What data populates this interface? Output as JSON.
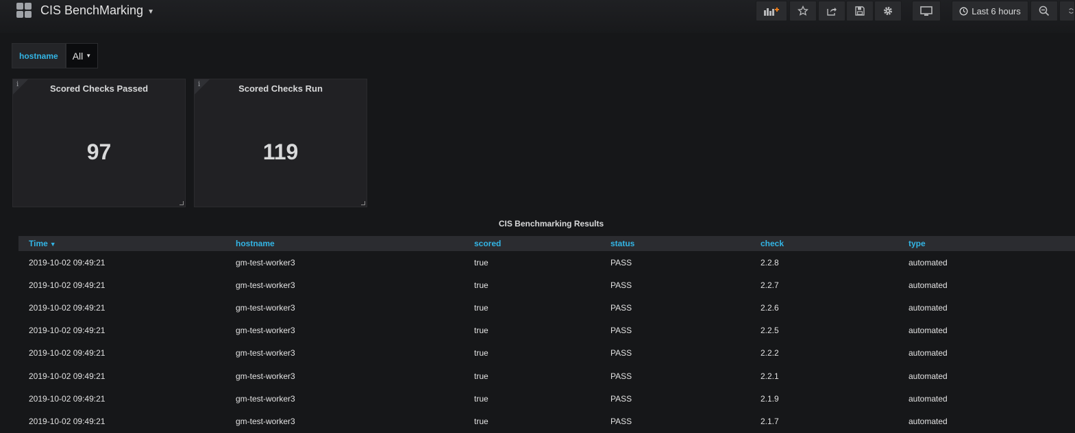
{
  "dashboard": {
    "title": "CIS BenchMarking"
  },
  "toolbar": {
    "time_range": "Last 6 hours"
  },
  "variables": {
    "hostname": {
      "label": "hostname",
      "value": "All"
    }
  },
  "panels": [
    {
      "title": "Scored Checks Passed",
      "value": "97"
    },
    {
      "title": "Scored Checks Run",
      "value": "119"
    }
  ],
  "table": {
    "title": "CIS Benchmarking Results",
    "columns": [
      "Time",
      "hostname",
      "scored",
      "status",
      "check",
      "type"
    ],
    "rows": [
      [
        "2019-10-02 09:49:21",
        "gm-test-worker3",
        "true",
        "PASS",
        "2.2.8",
        "automated"
      ],
      [
        "2019-10-02 09:49:21",
        "gm-test-worker3",
        "true",
        "PASS",
        "2.2.7",
        "automated"
      ],
      [
        "2019-10-02 09:49:21",
        "gm-test-worker3",
        "true",
        "PASS",
        "2.2.6",
        "automated"
      ],
      [
        "2019-10-02 09:49:21",
        "gm-test-worker3",
        "true",
        "PASS",
        "2.2.5",
        "automated"
      ],
      [
        "2019-10-02 09:49:21",
        "gm-test-worker3",
        "true",
        "PASS",
        "2.2.2",
        "automated"
      ],
      [
        "2019-10-02 09:49:21",
        "gm-test-worker3",
        "true",
        "PASS",
        "2.2.1",
        "automated"
      ],
      [
        "2019-10-02 09:49:21",
        "gm-test-worker3",
        "true",
        "PASS",
        "2.1.9",
        "automated"
      ],
      [
        "2019-10-02 09:49:21",
        "gm-test-worker3",
        "true",
        "PASS",
        "2.1.7",
        "automated"
      ]
    ]
  },
  "colors": {
    "accent": "#33b5e5",
    "background": "#161719",
    "panel": "#212124"
  }
}
